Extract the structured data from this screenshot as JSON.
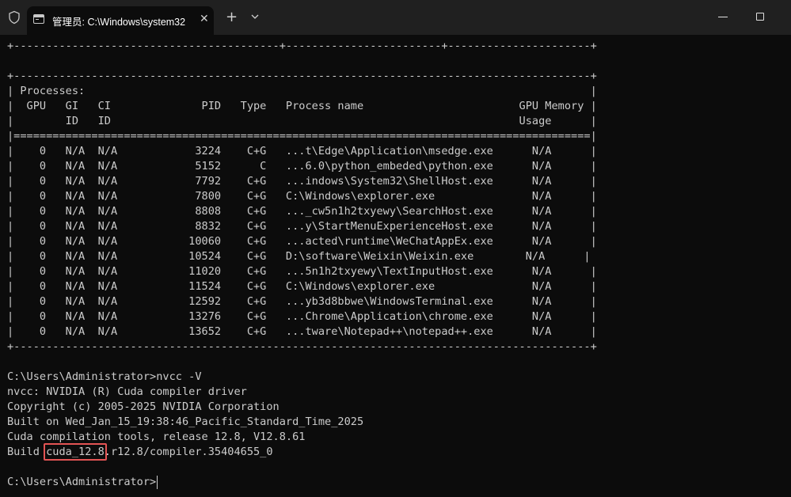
{
  "window": {
    "tab_title": "管理员: C:\\Windows\\system32",
    "tab_close": "✕",
    "new_tab": "+"
  },
  "terminal": {
    "lines": [
      "+-----------------------------------------+------------------------+----------------------+",
      "",
      "+-----------------------------------------------------------------------------------------+",
      "| Processes:                                                                              |",
      "|  GPU   GI   CI              PID   Type   Process name                        GPU Memory |",
      "|        ID   ID                                                               Usage      |",
      "|=========================================================================================|",
      "|    0   N/A  N/A            3224    C+G   ...t\\Edge\\Application\\msedge.exe      N/A      |",
      "|    0   N/A  N/A            5152      C   ...6.0\\python_embeded\\python.exe      N/A      |",
      "|    0   N/A  N/A            7792    C+G   ...indows\\System32\\ShellHost.exe      N/A      |",
      "|    0   N/A  N/A            7800    C+G   C:\\Windows\\explorer.exe               N/A      |",
      "|    0   N/A  N/A            8808    C+G   ..._cw5n1h2txyewy\\SearchHost.exe      N/A      |",
      "|    0   N/A  N/A            8832    C+G   ...y\\StartMenuExperienceHost.exe      N/A      |",
      "|    0   N/A  N/A           10060    C+G   ...acted\\runtime\\WeChatAppEx.exe      N/A      |",
      "|    0   N/A  N/A           10524    C+G   D:\\software\\Weixin\\Weixin.exe        N/A      |",
      "|    0   N/A  N/A           11020    C+G   ...5n1h2txyewy\\TextInputHost.exe      N/A      |",
      "|    0   N/A  N/A           11524    C+G   C:\\Windows\\explorer.exe               N/A      |",
      "|    0   N/A  N/A           12592    C+G   ...yb3d8bbwe\\WindowsTerminal.exe      N/A      |",
      "|    0   N/A  N/A           13276    C+G   ...Chrome\\Application\\chrome.exe      N/A      |",
      "|    0   N/A  N/A           13652    C+G   ...tware\\Notepad++\\notepad++.exe      N/A      |",
      "+-----------------------------------------------------------------------------------------+",
      "",
      "C:\\Users\\Administrator>nvcc -V",
      "nvcc: NVIDIA (R) Cuda compiler driver",
      "Copyright (c) 2005-2025 NVIDIA Corporation",
      "Built on Wed_Jan_15_19:38:46_Pacific_Standard_Time_2025",
      "Cuda compilation tools, release 12.8, V12.8.61",
      "Build cuda_12.8.r12.8/compiler.35404655_0",
      "",
      "C:\\Users\\Administrator>"
    ]
  },
  "highlight": {
    "text": "cuda_12.8",
    "color": "#e35454"
  },
  "colors": {
    "background": "#0c0c0c",
    "titlebar": "#202020",
    "text": "#cccccc"
  }
}
